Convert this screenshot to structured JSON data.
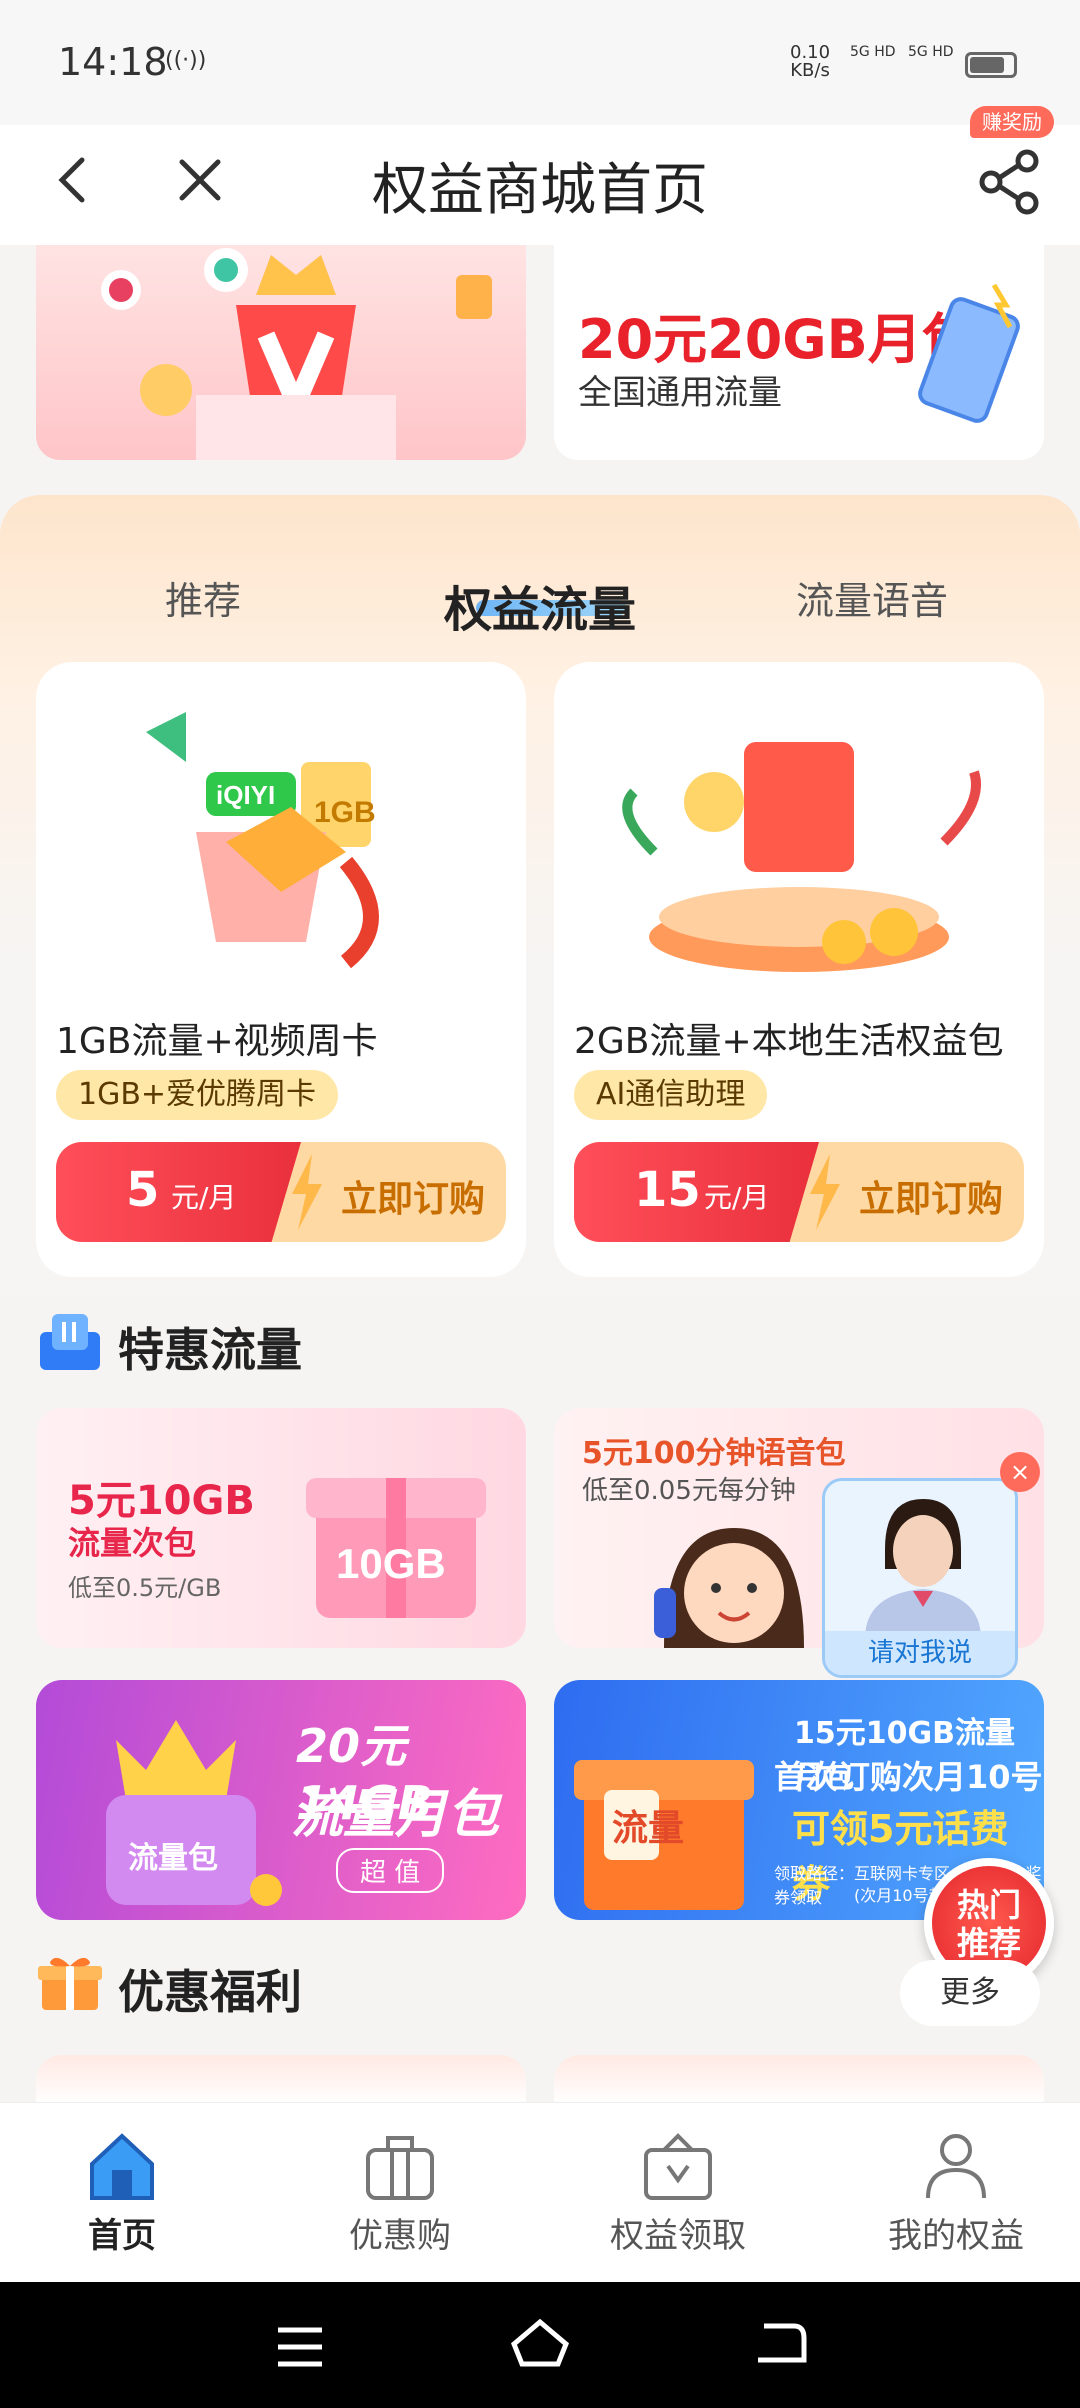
{
  "status_bar": {
    "time": "14:18",
    "network_icon": "((·))",
    "speed_value": "0.10",
    "speed_unit": "KB/s",
    "sim1": "5G HD",
    "sim2": "5G HD"
  },
  "header": {
    "title": "权益商城首页",
    "reward_badge": "赚奖励"
  },
  "top_banner_right": {
    "title": "20元20GB月包",
    "subtitle": "全国通用流量"
  },
  "tabs": [
    {
      "label": "推荐"
    },
    {
      "label": "权益流量"
    },
    {
      "label": "流量语音"
    }
  ],
  "products": [
    {
      "name": "1GB流量+视频周卡",
      "tag": "1GB+爱优腾周卡",
      "price": "5",
      "unit": "元/月",
      "cta": "立即订购",
      "image_text": "1GB",
      "image_brand": "iQIYI"
    },
    {
      "name": "2GB流量+本地生活权益包",
      "tag": "AI通信助理",
      "price": "15",
      "unit": "元/月",
      "cta": "立即订购"
    }
  ],
  "special_section": {
    "title": "特惠流量",
    "promos": [
      {
        "line1": "5元10GB",
        "line2": "流量次包",
        "line3": "低至0.5元/GB",
        "badge": "10GB"
      },
      {
        "line1": "5元100分钟语音包",
        "line2": "低至0.05元每分钟"
      },
      {
        "line1": "20元14GB",
        "line2": "流量月包",
        "line3": "超 值",
        "badge": "流量包"
      },
      {
        "line1": "15元10GB流量月包",
        "line2": "首次订购次月10号",
        "line3": "可领5元话费券",
        "line4": "领取路径：互联网卡专区-我的-我的奖券领取",
        "line5": "(次月10号起30天",
        "badge": "流量"
      }
    ]
  },
  "assistant": {
    "label": "请对我说"
  },
  "hot_button": {
    "line1": "热门",
    "line2": "推荐"
  },
  "welfare_section": {
    "title": "优惠福利",
    "more": "更多"
  },
  "tabbar": [
    {
      "label": "首页",
      "icon": "home-icon",
      "active": true
    },
    {
      "label": "优惠购",
      "icon": "bag-icon"
    },
    {
      "label": "权益领取",
      "icon": "box-icon"
    },
    {
      "label": "我的权益",
      "icon": "user-icon"
    }
  ],
  "colors": {
    "accent": "#e9303c",
    "tag_bg": "#ffe7a8",
    "cta_bg": "#ffd9a4",
    "section_bg": "#fde5cc"
  }
}
